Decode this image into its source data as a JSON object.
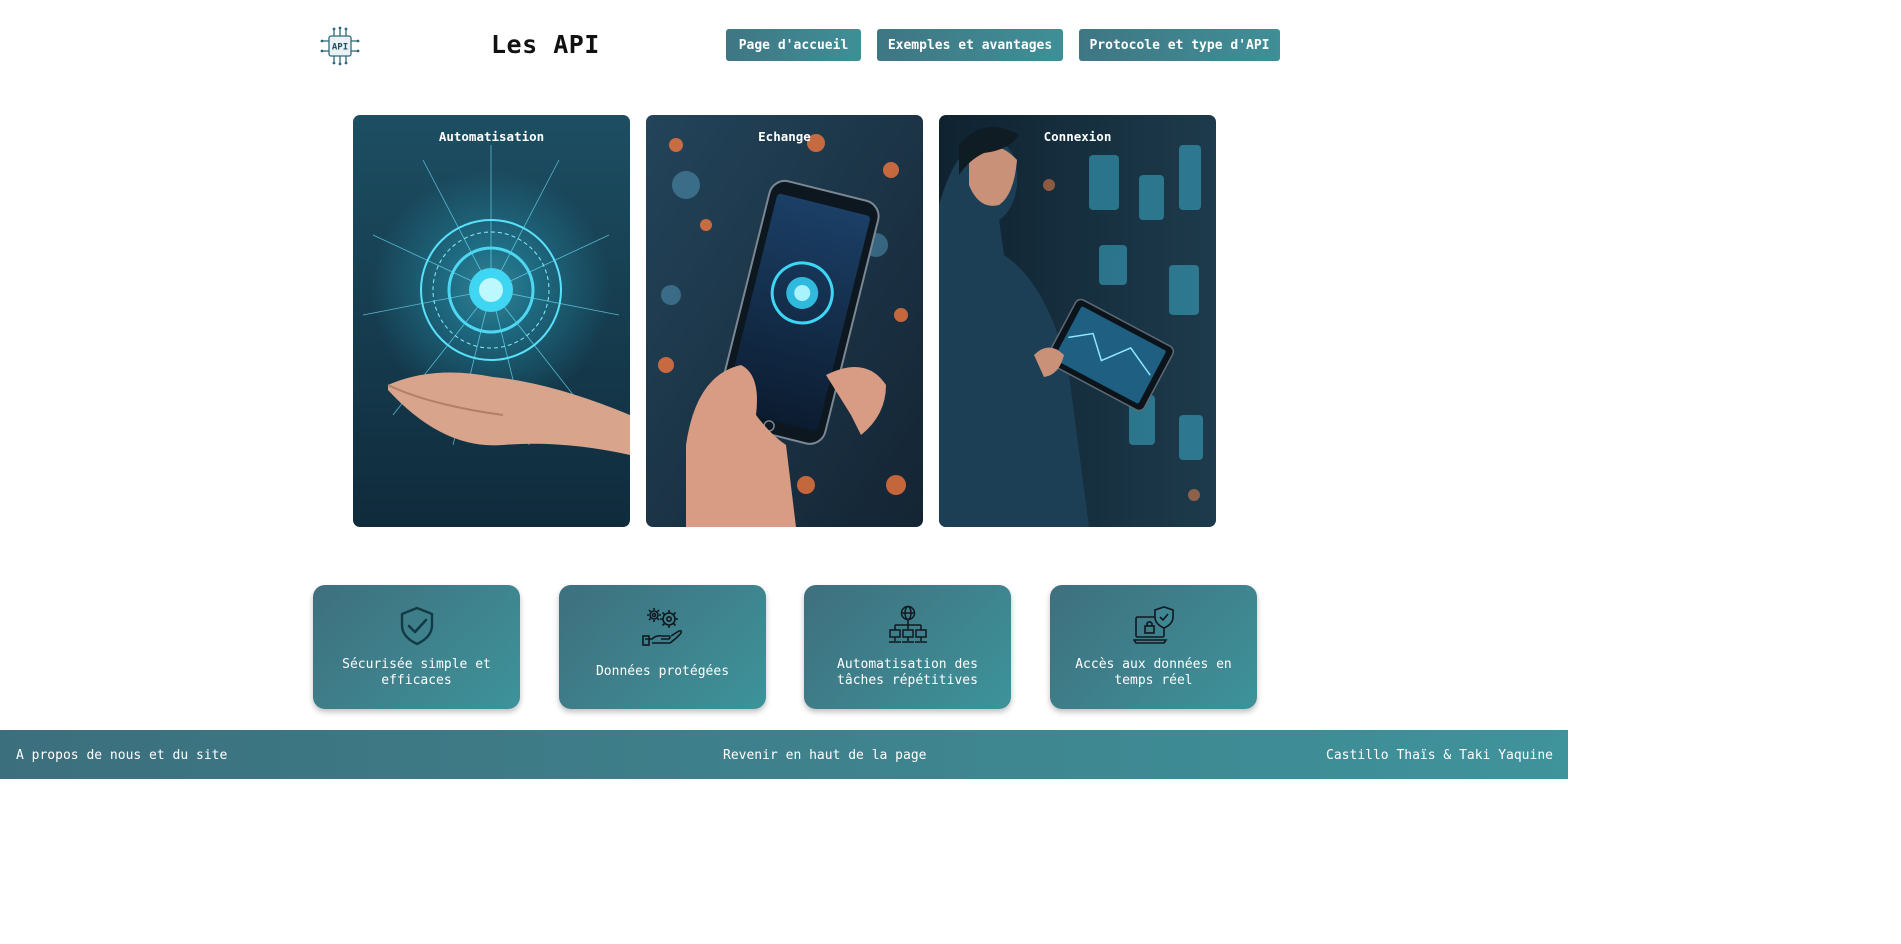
{
  "header": {
    "logo_text": "API",
    "title": "Les API",
    "nav": [
      "Page d'accueil",
      "Exemples et avantages",
      "Protocole et type d'API"
    ]
  },
  "cards": [
    {
      "title": "Automatisation",
      "image": "glowing-circuit-over-hand"
    },
    {
      "title": "Echange",
      "image": "hand-holding-smartphone"
    },
    {
      "title": "Connexion",
      "image": "person-using-tablet"
    }
  ],
  "features": [
    {
      "label": "Sécurisée simple et efficaces",
      "icon": "shield-check-icon"
    },
    {
      "label": "Données protégées",
      "icon": "gears-hand-icon"
    },
    {
      "label": "Automatisation des tâches répétitives",
      "icon": "network-globe-icon"
    },
    {
      "label": "Accès aux données en temps réel",
      "icon": "laptop-lock-shield-icon"
    }
  ],
  "footer": {
    "about": "A propos de nous et du site",
    "back_to_top": "Revenir en haut de la page",
    "authors": "Castillo Thaïs & Taki Yaquine"
  },
  "colors": {
    "accent_start": "#3f7683",
    "accent_end": "#3f939b"
  }
}
